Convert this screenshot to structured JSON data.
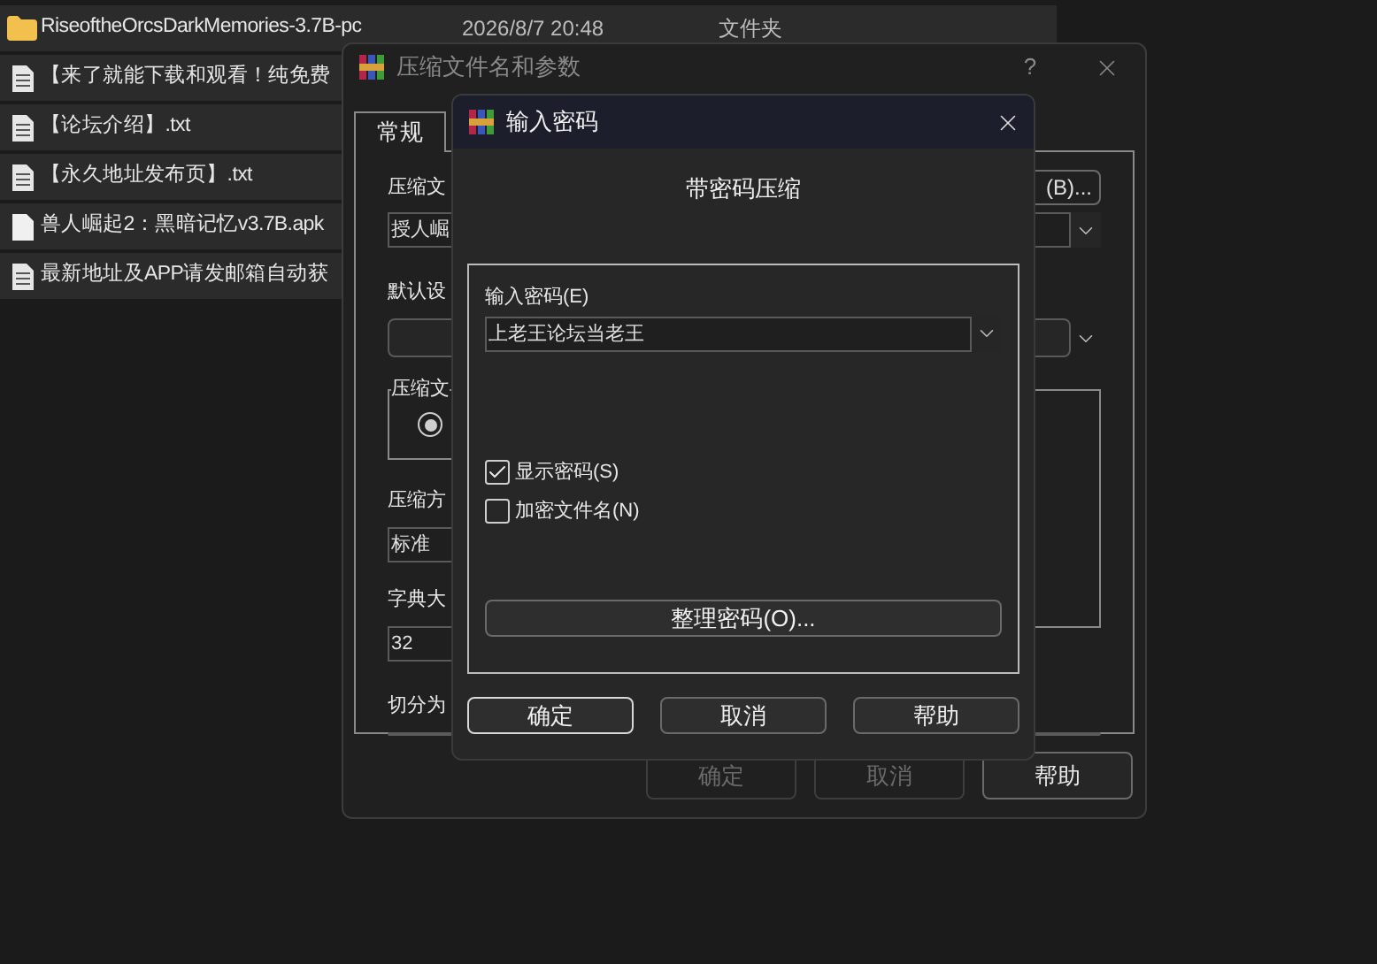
{
  "file_list": {
    "rows": [
      {
        "kind": "folder",
        "name": "RiseoftheOrcsDarkMemories-3.7B-pc",
        "date": "2026/8/7 20:48",
        "type": "文件夹"
      },
      {
        "kind": "text",
        "name": "【来了就能下载和观看！纯免费"
      },
      {
        "kind": "text",
        "name": "【论坛介绍】.txt"
      },
      {
        "kind": "text",
        "name": "【永久地址发布页】.txt"
      },
      {
        "kind": "file",
        "name": "兽人崛起2：黑暗记忆v3.7B.apk"
      },
      {
        "kind": "text",
        "name": "最新地址及APP请发邮箱自动获"
      }
    ]
  },
  "archive_window": {
    "title": "压缩文件名和参数",
    "help_button": "?",
    "tabs": [
      {
        "label": "常规",
        "selected": true
      }
    ],
    "archive_name_label": "压缩文",
    "browse_button": "(B)...",
    "archive_name_value": "授人崛",
    "profile_label": "默认设",
    "format_group_label": "压缩文",
    "format_radio_selected": true,
    "method_label": "压缩方",
    "method_value": "标准",
    "dictionary_label": "字典大",
    "dictionary_value": "32",
    "split_label": "切分为",
    "buttons": [
      {
        "label": "确定",
        "disabled": true
      },
      {
        "label": "取消",
        "disabled": true
      },
      {
        "label": "帮助",
        "disabled": false
      }
    ]
  },
  "password_dialog": {
    "title": "输入密码",
    "heading": "带密码压缩",
    "password_label": "输入密码(E)",
    "password_value": "上老王论坛当老王",
    "options": [
      {
        "label": "显示密码(S)",
        "checked": true
      },
      {
        "label": "加密文件名(N)",
        "checked": false
      }
    ],
    "organize_button": "整理密码(O)...",
    "buttons": [
      {
        "label": "确定",
        "default": true
      },
      {
        "label": "取消",
        "default": false
      },
      {
        "label": "帮助",
        "default": false
      }
    ]
  }
}
